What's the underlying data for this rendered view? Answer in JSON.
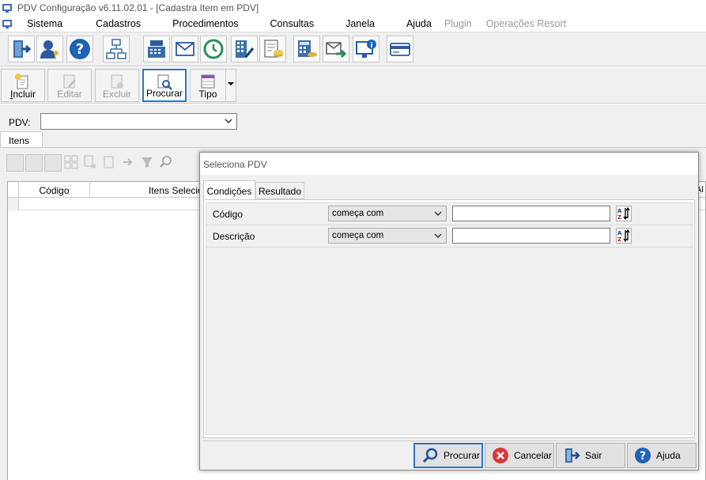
{
  "window": {
    "title": "PDV Configuração v6.11.02.01 - [Cadastra Item em PDV]"
  },
  "menu": {
    "items": [
      {
        "label": "Sistema",
        "disabled": false
      },
      {
        "label": "Cadastros",
        "disabled": false
      },
      {
        "label": "Procedimentos",
        "disabled": false
      },
      {
        "label": "Consultas",
        "disabled": false
      },
      {
        "label": "Janela",
        "disabled": false
      },
      {
        "label": "Ajuda",
        "disabled": false
      },
      {
        "label": "Plugin",
        "disabled": true
      },
      {
        "label": "Operações Resort",
        "disabled": true
      }
    ]
  },
  "toolbar2": {
    "incluir": "Incluir",
    "editar": "Editar",
    "excluir": "Excluir",
    "procurar": "Procurar",
    "tipo": "Tipo"
  },
  "filter": {
    "pdv_label": "PDV:",
    "pdv_value": ""
  },
  "tabs": {
    "itens": "Itens"
  },
  "grid": {
    "columns": [
      "Código",
      "Itens Selecionados",
      "Al"
    ]
  },
  "dialog": {
    "title": "Seleciona PDV",
    "tabs": [
      "Condições",
      "Resultado"
    ],
    "conditions": [
      {
        "label": "Código",
        "operator": "começa com",
        "value": ""
      },
      {
        "label": "Descrição",
        "operator": "começa com",
        "value": ""
      }
    ],
    "buttons": {
      "procurar": "Procurar",
      "cancelar": "Cancelar",
      "sair": "Sair",
      "ajuda": "Ajuda"
    }
  },
  "colors": {
    "accent": "#2b78c5",
    "cancel": "#d9363e",
    "help": "#1e63b5"
  }
}
